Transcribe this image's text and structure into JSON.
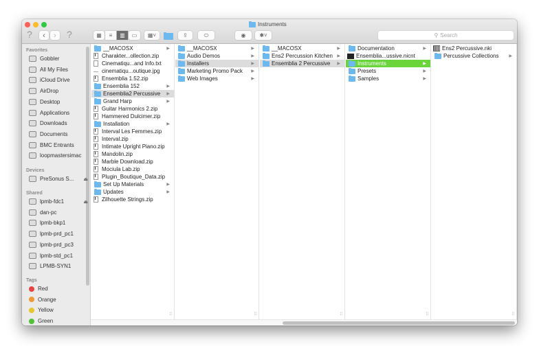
{
  "window": {
    "title": "Instruments"
  },
  "toolbar": {
    "help_left": "?",
    "help_right": "?",
    "back": "‹",
    "forward": "›",
    "search_placeholder": "Search"
  },
  "sidebar": {
    "sections": [
      {
        "title": "Favorites",
        "items": [
          {
            "label": "Gobbler",
            "icon": "folder-icon"
          },
          {
            "label": "All My Files",
            "icon": "all-files-icon"
          },
          {
            "label": "iCloud Drive",
            "icon": "cloud-icon"
          },
          {
            "label": "AirDrop",
            "icon": "airdrop-icon"
          },
          {
            "label": "Desktop",
            "icon": "desktop-icon"
          },
          {
            "label": "Applications",
            "icon": "applications-icon"
          },
          {
            "label": "Downloads",
            "icon": "downloads-icon"
          },
          {
            "label": "Documents",
            "icon": "documents-icon"
          },
          {
            "label": "BMC Entrants",
            "icon": "folder-icon"
          },
          {
            "label": "loopmastersimac",
            "icon": "home-icon"
          }
        ]
      },
      {
        "title": "Devices",
        "items": [
          {
            "label": "PreSonus S...",
            "icon": "drive-icon",
            "eject": true
          }
        ]
      },
      {
        "title": "Shared",
        "items": [
          {
            "label": "lpmb-fdc1",
            "icon": "computer-icon",
            "eject": true
          },
          {
            "label": "dan-pc",
            "icon": "computer-icon"
          },
          {
            "label": "lpmb-bkp1",
            "icon": "computer-icon"
          },
          {
            "label": "lpmb-prd_pc1",
            "icon": "computer-icon"
          },
          {
            "label": "lpmb-prd_pc3",
            "icon": "computer-icon"
          },
          {
            "label": "lpmb-std_pc1",
            "icon": "computer-icon"
          },
          {
            "label": "LPMB-SYN1",
            "icon": "server-icon"
          }
        ]
      },
      {
        "title": "Tags",
        "items": [
          {
            "label": "Red",
            "color": "#e64545"
          },
          {
            "label": "Orange",
            "color": "#ef9a3a"
          },
          {
            "label": "Yellow",
            "color": "#e6c633"
          },
          {
            "label": "Green",
            "color": "#54c13a"
          }
        ]
      }
    ]
  },
  "columns": [
    {
      "items": [
        {
          "label": "__MACOSX",
          "type": "folder",
          "arrow": true
        },
        {
          "label": "Charakter...ollection.zip",
          "type": "zip"
        },
        {
          "label": "Cinematiqu...and Info.txt",
          "type": "txt"
        },
        {
          "label": "cinematiqu...outique.jpg",
          "type": "jpg"
        },
        {
          "label": "Ensemblia 1.52.zip",
          "type": "zip"
        },
        {
          "label": "Ensemblia 152",
          "type": "folder",
          "arrow": true
        },
        {
          "label": "Ensemblia2 Percussive",
          "type": "folder",
          "arrow": true,
          "state": "selected"
        },
        {
          "label": "Grand Harp",
          "type": "folder",
          "arrow": true
        },
        {
          "label": "Guitar Harmonics 2.zip",
          "type": "zip"
        },
        {
          "label": "Hammered Dulcimer.zip",
          "type": "zip"
        },
        {
          "label": "Installation",
          "type": "folder",
          "arrow": true
        },
        {
          "label": "Interval Les Femmes.zip",
          "type": "zip"
        },
        {
          "label": "Interval.zip",
          "type": "zip"
        },
        {
          "label": "Intimate Upright Piano.zip",
          "type": "zip"
        },
        {
          "label": "Mandolin.zip",
          "type": "zip"
        },
        {
          "label": "Marble Download.zip",
          "type": "zip"
        },
        {
          "label": "Mociula Lab.zip",
          "type": "zip"
        },
        {
          "label": "Plugin_Boutique_Data.zip",
          "type": "zip"
        },
        {
          "label": "Set Up Materials",
          "type": "folder",
          "arrow": true
        },
        {
          "label": "Updates",
          "type": "folder",
          "arrow": true
        },
        {
          "label": "Zilhouette Strings.zip",
          "type": "zip"
        }
      ]
    },
    {
      "items": [
        {
          "label": "__MACOSX",
          "type": "folder",
          "arrow": true
        },
        {
          "label": "Audio Demos",
          "type": "folder",
          "arrow": true
        },
        {
          "label": "Installers",
          "type": "folder",
          "arrow": true,
          "state": "selected"
        },
        {
          "label": "Marketing Promo Pack",
          "type": "folder",
          "arrow": true
        },
        {
          "label": "Web Images",
          "type": "folder",
          "arrow": true
        }
      ]
    },
    {
      "items": [
        {
          "label": "__MACOSX",
          "type": "folder",
          "arrow": true
        },
        {
          "label": "Ens2 Percussion Kitchen",
          "type": "folder",
          "arrow": true
        },
        {
          "label": "Ensemblia 2 Percussive",
          "type": "folder",
          "arrow": true,
          "state": "selected"
        }
      ]
    },
    {
      "items": [
        {
          "label": "Documentation",
          "type": "folder",
          "arrow": true
        },
        {
          "label": "Ensemblia...ussive.nicnt",
          "type": "nicnt"
        },
        {
          "label": "Instruments",
          "type": "folder",
          "arrow": true,
          "state": "active"
        },
        {
          "label": "Presets",
          "type": "folder",
          "arrow": true
        },
        {
          "label": "Samples",
          "type": "folder",
          "arrow": true
        }
      ]
    },
    {
      "items": [
        {
          "label": "Ens2 Percussive.nki",
          "type": "nki"
        },
        {
          "label": "Percussive Collections",
          "type": "folder",
          "arrow": true
        }
      ]
    }
  ]
}
